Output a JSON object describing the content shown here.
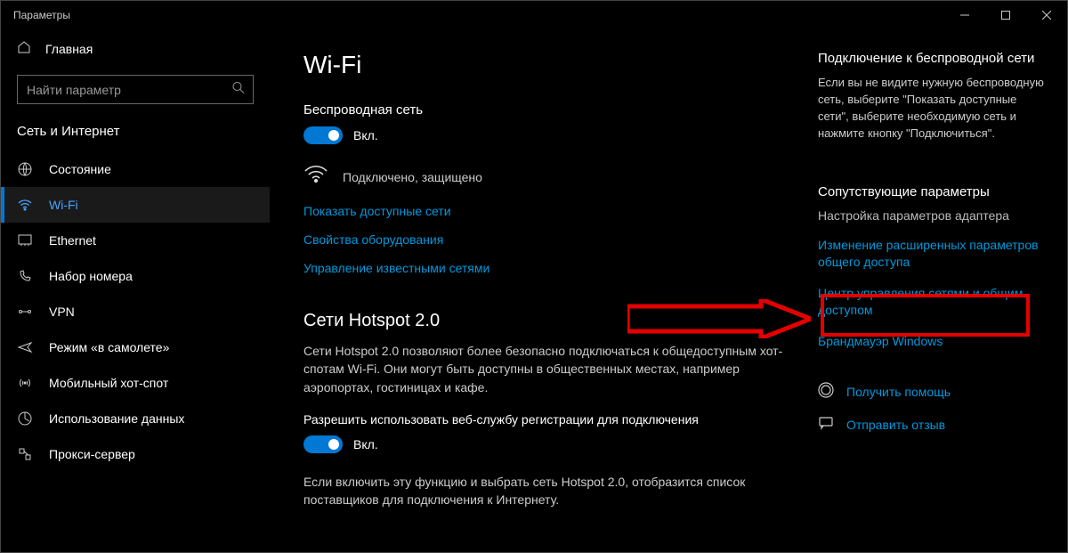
{
  "window": {
    "title": "Параметры"
  },
  "sidebar": {
    "home": "Главная",
    "search_placeholder": "Найти параметр",
    "category": "Сеть и Интернет",
    "items": [
      {
        "label": "Состояние"
      },
      {
        "label": "Wi-Fi"
      },
      {
        "label": "Ethernet"
      },
      {
        "label": "Набор номера"
      },
      {
        "label": "VPN"
      },
      {
        "label": "Режим «в самолете»"
      },
      {
        "label": "Мобильный хот-спот"
      },
      {
        "label": "Использование данных"
      },
      {
        "label": "Прокси-сервер"
      }
    ]
  },
  "main": {
    "title": "Wi-Fi",
    "wireless_header": "Беспроводная сеть",
    "toggle1": "Вкл.",
    "status": "Подключено, защищено",
    "link_show": "Показать доступные сети",
    "link_hw": "Свойства оборудования",
    "link_known": "Управление известными сетями",
    "hotspot_header": "Сети Hotspot 2.0",
    "hotspot_desc": "Сети Hotspot 2.0 позволяют более безопасно подключаться к общедоступным хот-спотам Wi-Fi. Они могут быть доступны в общественных местах, например аэропортах, гостиницах и кафе.",
    "allow_text": "Разрешить использовать веб-службу регистрации для подключения",
    "toggle2": "Вкл.",
    "footer_desc": "Если включить эту функцию и выбрать сеть Hotspot 2.0, отобразится список поставщиков для подключения к Интернету."
  },
  "right": {
    "h1": "Подключение к беспроводной сети",
    "p1": "Если вы не видите нужную беспроводную сеть, выберите \"Показать доступные сети\", выберите необходимую сеть и нажмите кнопку \"Подключиться\".",
    "h2": "Сопутствующие параметры",
    "adapter": "Настройка параметров адаптера",
    "advanced": "Изменение расширенных параметров общего доступа",
    "center": "Центр управления сетями и общим доступом",
    "firewall": "Брандмауэр Windows",
    "help": "Получить помощь",
    "feedback": "Отправить отзыв"
  }
}
